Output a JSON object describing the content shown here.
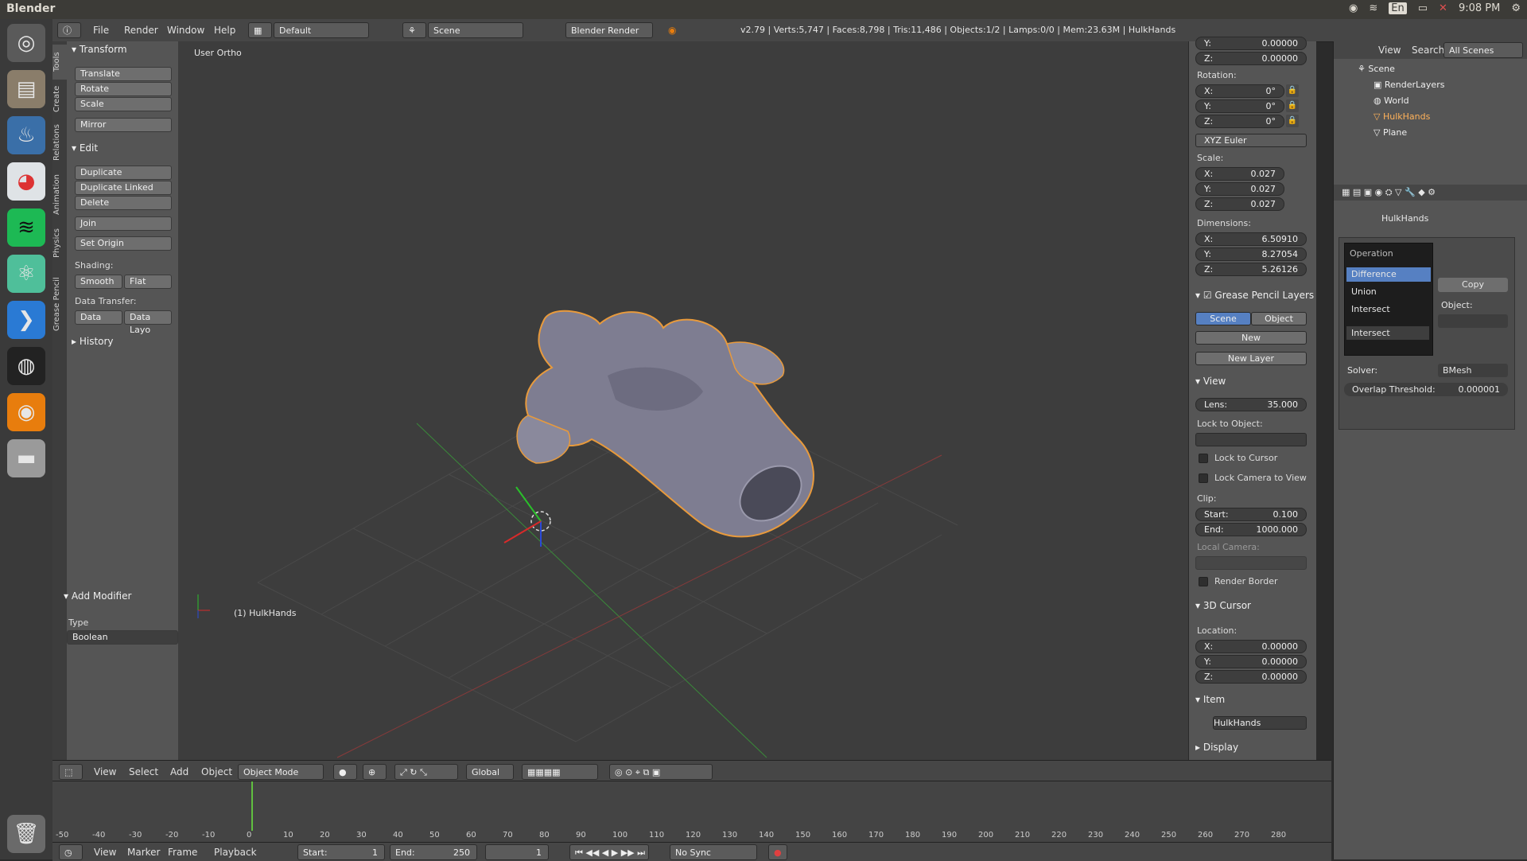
{
  "os": {
    "title": "Blender",
    "lang": "En",
    "clock": "9:08 PM"
  },
  "header": {
    "menus": [
      "File",
      "Render",
      "Window",
      "Help"
    ],
    "layout": "Default",
    "scene": "Scene",
    "engine": "Blender Render",
    "stats": "v2.79 | Verts:5,747 | Faces:8,798 | Tris:11,486 | Objects:1/2 | Lamps:0/0 | Mem:23.63M | HulkHands"
  },
  "vtabs": [
    "Tools",
    "Create",
    "Relations",
    "Animation",
    "Physics",
    "Grease Pencil"
  ],
  "toolshelf": {
    "transform_title": "Transform",
    "translate": "Translate",
    "rotate": "Rotate",
    "scale": "Scale",
    "mirror": "Mirror",
    "edit_title": "Edit",
    "duplicate": "Duplicate",
    "duplicate_linked": "Duplicate Linked",
    "delete": "Delete",
    "join": "Join",
    "set_origin": "Set Origin",
    "shading_label": "Shading:",
    "smooth": "Smooth",
    "flat": "Flat",
    "data_transfer_label": "Data Transfer:",
    "data": "Data",
    "data_layo": "Data Layo",
    "history_title": "History",
    "add_modifier_title": "Add Modifier",
    "type_label": "Type",
    "type_value": "Boolean"
  },
  "viewport": {
    "view_name": "User Ortho",
    "object_label": "(1) HulkHands",
    "menus": [
      "View",
      "Select",
      "Add",
      "Object"
    ],
    "mode": "Object Mode",
    "orientation": "Global"
  },
  "npanel": {
    "loc_y": "0.00000",
    "loc_z": "0.00000",
    "rotation_label": "Rotation:",
    "rot_x": "0°",
    "rot_y": "0°",
    "rot_z": "0°",
    "rot_mode": "XYZ Euler",
    "scale_label": "Scale:",
    "scale_x": "0.027",
    "scale_y": "0.027",
    "scale_z": "0.027",
    "dim_label": "Dimensions:",
    "dim_x": "6.50910",
    "dim_y": "8.27054",
    "dim_z": "5.26126",
    "gp_title": "Grease Pencil Layers",
    "gp_scene": "Scene",
    "gp_object": "Object",
    "gp_new": "New",
    "gp_new_layer": "New Layer",
    "view_title": "View",
    "lens_label": "Lens:",
    "lens_value": "35.000",
    "lock_obj_label": "Lock to Object:",
    "lock_cursor": "Lock to Cursor",
    "lock_camera": "Lock Camera to View",
    "clip_label": "Clip:",
    "clip_start_label": "Start:",
    "clip_start": "0.100",
    "clip_end_label": "End:",
    "clip_end": "1000.000",
    "local_camera": "Local Camera:",
    "render_border": "Render Border",
    "cursor_title": "3D Cursor",
    "location_label": "Location:",
    "cur_x": "0.00000",
    "cur_y": "0.00000",
    "cur_z": "0.00000",
    "item_title": "Item",
    "item_name": "HulkHands",
    "display_title": "Display"
  },
  "outliner": {
    "menu_view": "View",
    "menu_search": "Search",
    "filter": "All Scenes",
    "rows": [
      "Scene",
      "RenderLayers",
      "World",
      "HulkHands",
      "Plane"
    ]
  },
  "properties": {
    "object_name": "HulkHands",
    "operation_title": "Operation",
    "options": [
      "Difference",
      "Union",
      "Intersect"
    ],
    "copy": "Copy",
    "object_label": "Object:",
    "intersect_value": "Intersect",
    "solver_label": "Solver:",
    "solver_value": "BMesh",
    "overlap_label": "Overlap Threshold:",
    "overlap_value": "0.000001"
  },
  "timeline": {
    "ticks": [
      "-50",
      "-40",
      "-30",
      "-20",
      "-10",
      "0",
      "10",
      "20",
      "30",
      "40",
      "50",
      "60",
      "70",
      "80",
      "90",
      "100",
      "110",
      "120",
      "130",
      "140",
      "150",
      "160",
      "170",
      "180",
      "190",
      "200",
      "210",
      "220",
      "230",
      "240",
      "250",
      "260",
      "270",
      "280"
    ],
    "menus": [
      "View",
      "Marker",
      "Frame",
      "Playback"
    ],
    "start_label": "Start:",
    "start": "1",
    "end_label": "End:",
    "end": "250",
    "current": "1",
    "sync": "No Sync"
  }
}
